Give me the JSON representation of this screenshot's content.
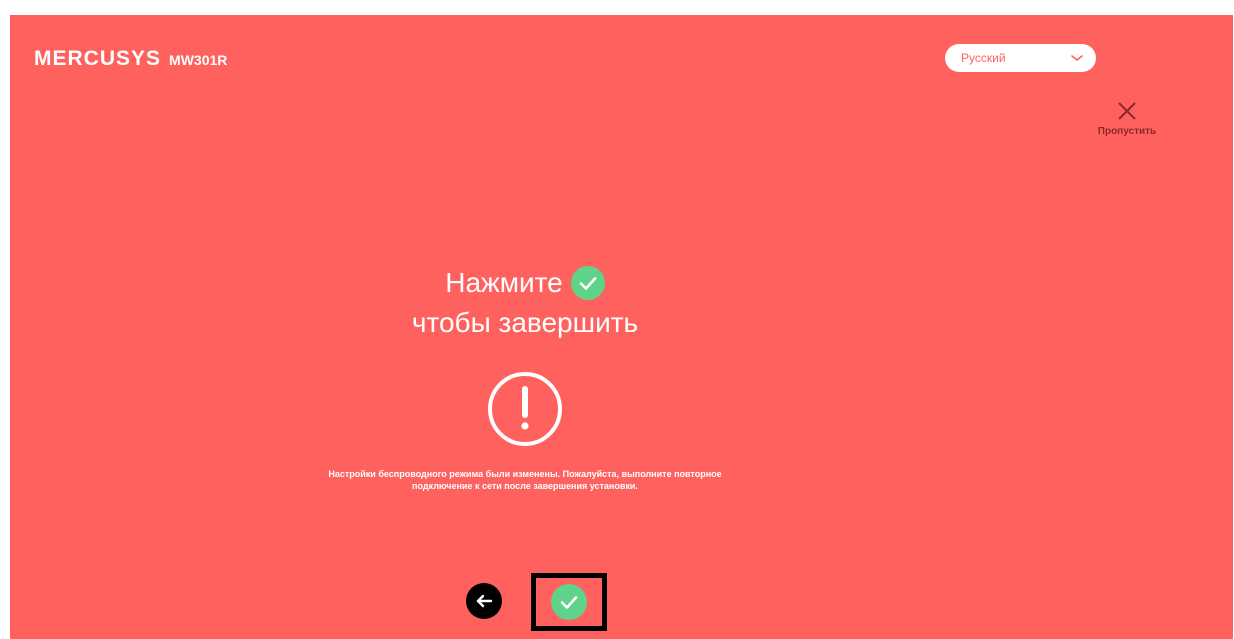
{
  "header": {
    "brand": "MERCUSYS",
    "model": "MW301R",
    "language_select": {
      "selected": "Русский",
      "icon": "chevron-down-icon"
    },
    "skip": {
      "label": "Пропустить",
      "icon": "close-icon"
    }
  },
  "main": {
    "instruction_line1": "Нажмите",
    "instruction_icon": "check-circle-icon",
    "instruction_line2": "чтобы завершить",
    "warning_icon": "exclamation-circle-icon",
    "message_line1": "Настройки беспроводного режима были изменены. Пожалуйста, выполните повторное",
    "message_line2": "подключение к сети после завершения установки."
  },
  "footer": {
    "back_icon": "arrow-left-icon",
    "finish_icon": "check-circle-icon"
  },
  "colors": {
    "background": "#ff615f",
    "accent_green": "#5fd38a",
    "text": "#ffffff",
    "highlight_border": "#000000"
  }
}
